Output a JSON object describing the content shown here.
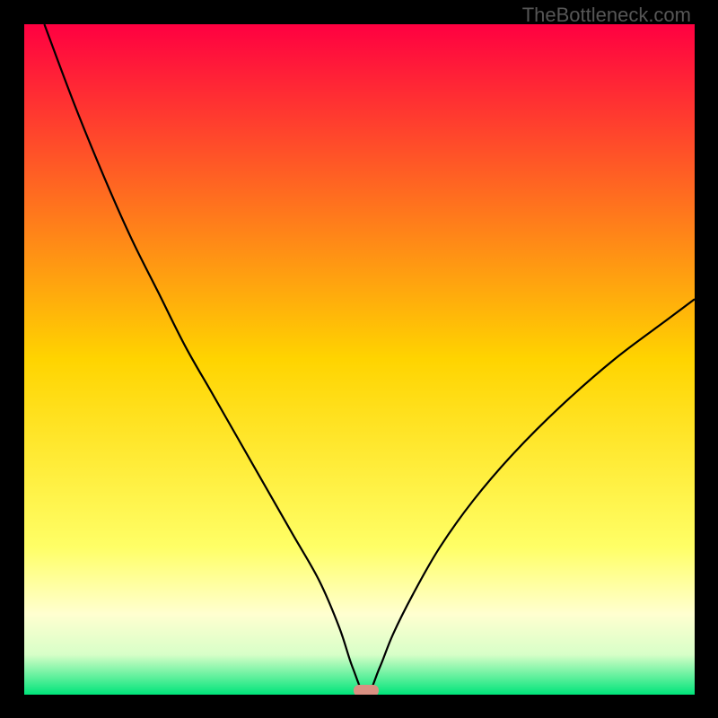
{
  "watermark": "TheBottleneck.com",
  "chart_data": {
    "type": "line",
    "title": "",
    "xlabel": "",
    "ylabel": "",
    "xlim": [
      0,
      100
    ],
    "ylim": [
      0,
      100
    ],
    "minimum_marker": {
      "x": 51,
      "y": 0
    },
    "gradient_stops": [
      {
        "pos": 0.0,
        "color": "#ff0041"
      },
      {
        "pos": 0.5,
        "color": "#ffd400"
      },
      {
        "pos": 0.78,
        "color": "#ffff66"
      },
      {
        "pos": 0.88,
        "color": "#ffffd0"
      },
      {
        "pos": 0.94,
        "color": "#d8ffc8"
      },
      {
        "pos": 1.0,
        "color": "#00e47a"
      }
    ],
    "series": [
      {
        "name": "bottleneck-curve",
        "x": [
          3,
          7.5,
          12,
          16,
          20,
          24,
          28,
          32,
          36,
          40,
          44,
          47,
          49,
          51,
          53,
          55,
          58,
          62,
          67,
          73,
          80,
          88,
          96,
          100
        ],
        "y": [
          100,
          88,
          77,
          68,
          60,
          52,
          45,
          38,
          31,
          24,
          17,
          10,
          4,
          0,
          4,
          9,
          15,
          22,
          29,
          36,
          43,
          50,
          56,
          59
        ]
      }
    ]
  }
}
